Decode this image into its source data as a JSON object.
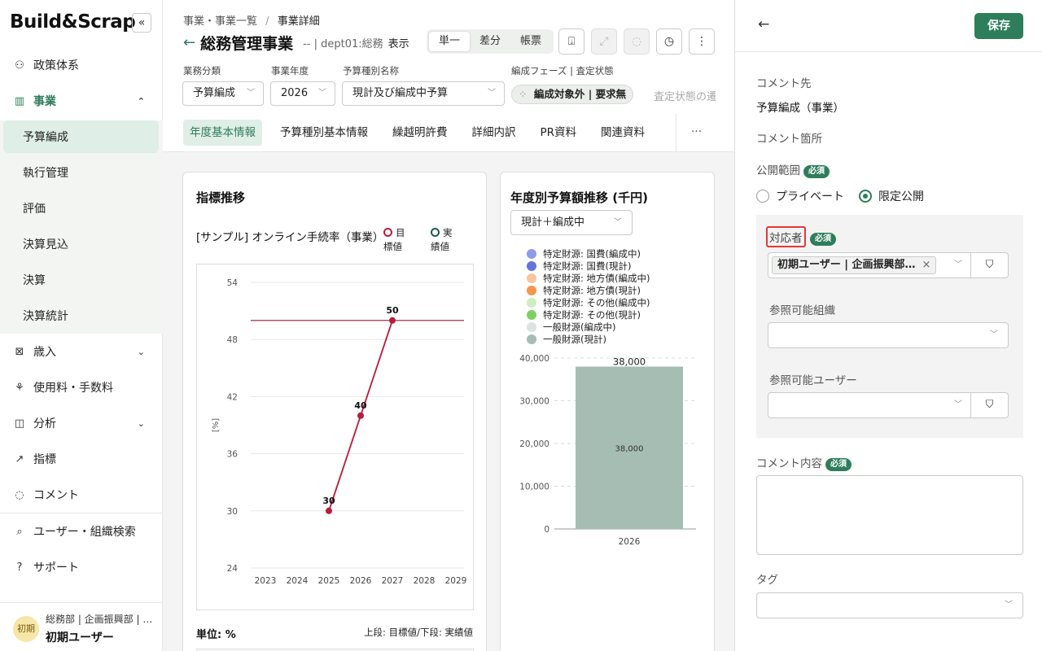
{
  "sidebar": {
    "logo": "Build&Scrap",
    "collapse_icon": "«",
    "items": [
      {
        "label": "政策体系",
        "icon": "⚇"
      },
      {
        "label": "事業",
        "icon": "▥",
        "chev": "⌃"
      },
      {
        "label": "歳入",
        "icon": "⊠",
        "chev": "⌄"
      },
      {
        "label": "使用料・手数料",
        "icon": "⚘"
      },
      {
        "label": "分析",
        "icon": "◫",
        "chev": "⌄"
      },
      {
        "label": "指標",
        "icon": "↗"
      },
      {
        "label": "コメント",
        "icon": "◌"
      }
    ],
    "sub_items": [
      "予算編成",
      "執行管理",
      "評価",
      "決算見込",
      "決算",
      "決算統計"
    ],
    "bottom_items": [
      {
        "label": "ユーザー・組織検索",
        "icon": "⌕"
      },
      {
        "label": "サポート",
        "icon": "?"
      }
    ],
    "user": {
      "avatar": "初期",
      "org": "総務部 | 企画振興部 | …",
      "name": "初期ユーザー"
    }
  },
  "main": {
    "breadcrumb": {
      "parent": "事業・事業一覧",
      "sep": "/",
      "current": "事業詳細"
    },
    "title": "総務管理事業",
    "title_meta": "-- | dept01:総務",
    "title_show": "表示",
    "view_modes": [
      "単一",
      "差分",
      "帳票"
    ],
    "toolbar_icons": [
      "export-icon",
      "trend-icon",
      "comment-icon",
      "history-icon",
      "more-icon"
    ],
    "toolbar_glyphs": [
      "⍗",
      "⤢",
      "◌",
      "◷",
      "⋮"
    ],
    "filters": {
      "category_label": "業務分類",
      "category_value": "予算編成",
      "year_label": "事業年度",
      "year_value": "2026",
      "budget_type_label": "予算種別名称",
      "budget_type_value": "現計及び編成中予算",
      "phase_label": "編成フェーズ | 査定状態",
      "phase_value": "編成対象外 | 要求無",
      "phase_grey": "査定状態の遷"
    },
    "tabs": [
      "年度基本情報",
      "予算種別基本情報",
      "繰越明許費",
      "詳細内訳",
      "PR資料",
      "関連資料"
    ],
    "tab_more": "···",
    "indicator_card": {
      "title": "指標推移",
      "indicator_name": "[サンプル] オンライン手続率（事業）",
      "legend_target": "目標値",
      "legend_actual": "実績値",
      "unit": "単位: %",
      "unit_note": "上段: 目標値/下段: 実績値"
    },
    "budget_card": {
      "title": "年度別予算額推移 (千円)",
      "select_value": "現計＋編成中",
      "legend": [
        {
          "name": "特定財源: 国費(編成中)",
          "color": "#8f9be8"
        },
        {
          "name": "特定財源: 国費(現計)",
          "color": "#6573db"
        },
        {
          "name": "特定財源: 地方債(編成中)",
          "color": "#f6c59d"
        },
        {
          "name": "特定財源: 地方債(現計)",
          "color": "#f39650"
        },
        {
          "name": "特定財源: その他(編成中)",
          "color": "#cdeec0"
        },
        {
          "name": "特定財源: その他(現計)",
          "color": "#7fd062"
        },
        {
          "name": "一般財源(編成中)",
          "color": "#dbe3df"
        },
        {
          "name": "一般財源(現計)",
          "color": "#a6bdb3"
        }
      ]
    }
  },
  "chart_data": [
    {
      "type": "line",
      "title": "[サンプル] オンライン手続率（事業）",
      "xlabel": "",
      "ylabel": "[%]",
      "x": [
        2023,
        2024,
        2025,
        2026,
        2027,
        2028,
        2029
      ],
      "yticks": [
        24,
        30,
        36,
        42,
        48,
        54
      ],
      "ylim": [
        24,
        54
      ],
      "series": [
        {
          "name": "目標値",
          "color": "#b71c3c",
          "values": [
            null,
            null,
            30,
            40,
            50,
            null,
            null
          ]
        }
      ],
      "target_line": 50,
      "data_labels": [
        "30",
        "40",
        "50"
      ],
      "grid": true
    },
    {
      "type": "bar",
      "categories": [
        "2026"
      ],
      "yticks": [
        "0",
        "10,000",
        "20,000",
        "30,000",
        "40,000"
      ],
      "ylim": [
        0,
        40000
      ],
      "series": [
        {
          "name": "一般財源(現計)",
          "color": "#a6bdb3",
          "values": [
            38000
          ]
        }
      ],
      "top_label": "38,000",
      "inner_label": "38,000",
      "grid": true
    }
  ],
  "panel": {
    "back_icon": "←",
    "save_label": "保存",
    "comment_to_label": "コメント先",
    "comment_to_value": "予算編成（事業）",
    "comment_place_label": "コメント箇所",
    "visibility_label": "公開範囲",
    "required": "必須",
    "private_label": "プライベート",
    "limited_label": "限定公開",
    "assignee_label": "対応者",
    "assignee_chip": "初期ユーザー | 企画振興部…",
    "chip_remove": "×",
    "ref_org_label": "参照可能組織",
    "ref_user_label": "参照可能ユーザー",
    "content_label": "コメント内容",
    "tag_label": "タグ",
    "filter_icon": "⛉",
    "arrow": "﹀"
  }
}
